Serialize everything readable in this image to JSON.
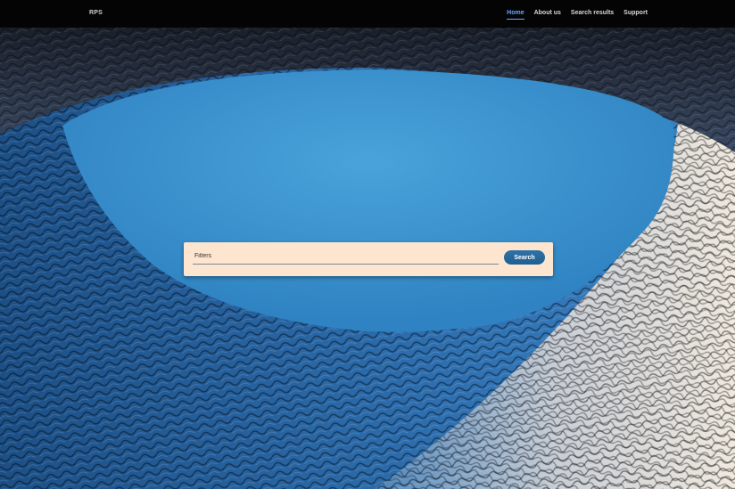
{
  "navbar": {
    "brand": "RPS",
    "links": [
      {
        "label": "Home",
        "active": true
      },
      {
        "label": "About us",
        "active": false
      },
      {
        "label": "Search results",
        "active": false
      },
      {
        "label": "Support",
        "active": false
      }
    ]
  },
  "hero": {
    "image": "architecture-mesh-facade-blue-sky",
    "sky_color": "#3d95d0",
    "facade_color": "#2a5f9a"
  },
  "search": {
    "placeholder": "Filters",
    "value": "",
    "button_label": "Search"
  },
  "colors": {
    "accent": "#66aaff",
    "panel": "#fde5cf",
    "button": "#2a6a9e"
  }
}
